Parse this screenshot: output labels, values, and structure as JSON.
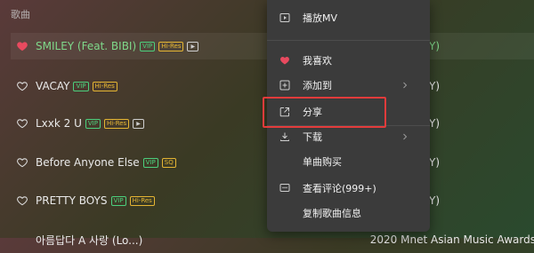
{
  "list": {
    "header": "歌曲",
    "rows": [
      {
        "title": "SMILEY (Feat. BIBI)",
        "badges": [
          "VIP",
          "Hi-Res",
          "▶"
        ],
        "artist": "EY)",
        "liked": true
      },
      {
        "title": "VACAY",
        "badges": [
          "VIP",
          "Hi-Res"
        ],
        "artist": "EY)",
        "liked": false
      },
      {
        "title": "Lxxk 2 U",
        "badges": [
          "VIP",
          "Hi-Res",
          "▶"
        ],
        "artist": "EY)",
        "liked": false
      },
      {
        "title": "Before Anyone Else",
        "badges": [
          "VIP",
          "SQ"
        ],
        "artist": "EY)",
        "liked": false
      },
      {
        "title": "PRETTY BOYS",
        "badges": [
          "VIP",
          "Hi-Res"
        ],
        "artist": "EY)",
        "liked": false
      },
      {
        "title": "아름답다 A 사랑 (Lo...)",
        "badges": [],
        "artist": "2020 Mnet Asian Music Awards",
        "liked": false
      }
    ]
  },
  "menu": {
    "items": [
      {
        "label": "播放MV",
        "icon": "play-mv-icon"
      },
      {
        "label": "我喜欢",
        "icon": "heart-icon"
      },
      {
        "label": "添加到",
        "icon": "add-icon",
        "submenu": true
      },
      {
        "label": "分享",
        "icon": "share-icon"
      },
      {
        "label": "下载",
        "icon": "download-icon",
        "submenu": true
      },
      {
        "label": "单曲购买",
        "icon": ""
      },
      {
        "label": "查看评论(999+)",
        "icon": "comment-icon"
      },
      {
        "label": "复制歌曲信息",
        "icon": ""
      }
    ]
  },
  "colors": {
    "accent": "#7fd88a",
    "menu_bg": "#3b3b3b",
    "highlight": "#e43b3b",
    "vip": "#4cd07d",
    "hires": "#e5b533"
  }
}
